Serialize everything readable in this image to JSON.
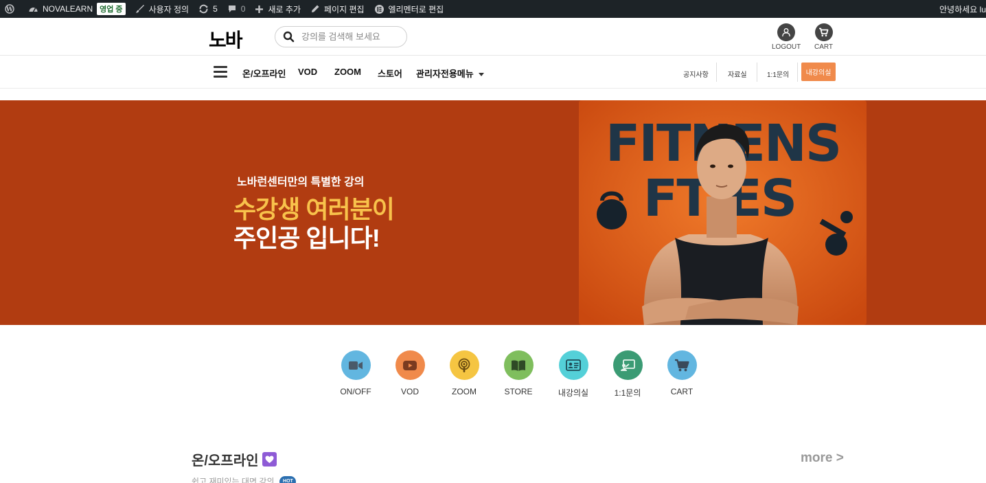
{
  "adminbar": {
    "site_name": "NOVALEARN",
    "status_badge": "영업 중",
    "customize": "사용자 정의",
    "updates_count": "5",
    "comments_count": "0",
    "new_item": "새로 추가",
    "edit_page": "페이지 편집",
    "elementor_edit": "엘리멘터로 편집",
    "greeting": "안녕하세요 luc"
  },
  "header": {
    "logo": "노바",
    "search_placeholder": "강의를 검색해 보세요",
    "logout_label": "LOGOUT",
    "cart_label": "CART"
  },
  "nav": {
    "items": [
      "온/오프라인",
      "VOD",
      "ZOOM",
      "스토어",
      "관리자전용메뉴"
    ],
    "utility": [
      "공지사항",
      "자료실",
      "1:1문의"
    ],
    "my_room": "내강의실"
  },
  "banner": {
    "subtitle": "노바런센터만의 특별한 강의",
    "headline_1": "수강생 여러분이",
    "headline_2": "주인공 입니다!",
    "photo_text": "FITNENS FTIES",
    "bg_color": "#b13c11"
  },
  "categories": [
    {
      "label": "ON/OFF",
      "icon": "video-camera-icon",
      "color": "#62b6e0"
    },
    {
      "label": "VOD",
      "icon": "play-icon",
      "color": "#f08a4b"
    },
    {
      "label": "ZOOM",
      "icon": "podcast-icon",
      "color": "#f5c542"
    },
    {
      "label": "STORE",
      "icon": "book-icon",
      "color": "#7fbe5d"
    },
    {
      "label": "내강의실",
      "icon": "id-card-icon",
      "color": "#54d0d8"
    },
    {
      "label": "1:1문의",
      "icon": "chalkboard-teacher-icon",
      "color": "#3b9b74"
    },
    {
      "label": "CART",
      "icon": "cart-icon",
      "color": "#62b6e0"
    }
  ],
  "section": {
    "title": "온/오프라인",
    "more": "more >",
    "subtitle": "쉽고 재미있는 대면 강의",
    "hot": "HOT"
  }
}
